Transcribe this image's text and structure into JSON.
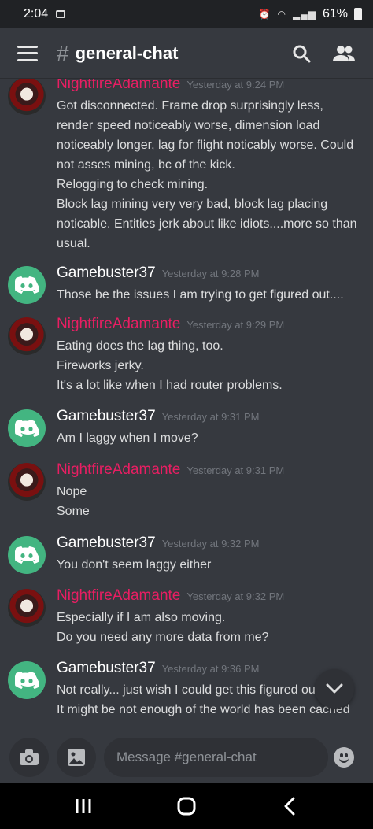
{
  "status_bar": {
    "time": "2:04",
    "battery": "61%"
  },
  "header": {
    "hash": "#",
    "channel": "general-chat"
  },
  "messages": [
    {
      "author": "NightfireAdamante",
      "avatar": "nightfire-avatar",
      "timestamp": "Yesterday at 9:24 PM",
      "lines": [
        "Got disconnected. Frame drop surprisingly less,",
        "render speed noticeably worse, dimension load",
        "noticeably longer, lag for flight noticably worse. Could",
        "not asses mining, bc of the kick.",
        "Relogging to check mining.",
        "Block lag mining very very bad, block lag placing",
        "noticable. Entities jerk about like idiots....more so than",
        "usual."
      ]
    },
    {
      "author": "Gamebuster37",
      "avatar": "discord-avatar",
      "timestamp": "Yesterday at 9:28 PM",
      "lines": [
        "Those be the issues I am trying to get figured out...."
      ]
    },
    {
      "author": "NightfireAdamante",
      "avatar": "nightfire-avatar",
      "timestamp": "Yesterday at 9:29 PM",
      "lines": [
        "Eating does the lag thing, too.",
        "Fireworks jerky.",
        "It's a lot like when I had router problems."
      ]
    },
    {
      "author": "Gamebuster37",
      "avatar": "discord-avatar",
      "timestamp": "Yesterday at 9:31 PM",
      "lines": [
        "Am I laggy when I move?"
      ]
    },
    {
      "author": "NightfireAdamante",
      "avatar": "nightfire-avatar",
      "timestamp": "Yesterday at 9:31 PM",
      "lines": [
        "Nope",
        "Some"
      ]
    },
    {
      "author": "Gamebuster37",
      "avatar": "discord-avatar",
      "timestamp": "Yesterday at 9:32 PM",
      "lines": [
        "You don't seem laggy either"
      ]
    },
    {
      "author": "NightfireAdamante",
      "avatar": "nightfire-avatar",
      "timestamp": "Yesterday at 9:32 PM",
      "lines": [
        "Especially if I am also moving.",
        "Do you need any more data from me?"
      ]
    },
    {
      "author": "Gamebuster37",
      "avatar": "discord-avatar",
      "timestamp": "Yesterday at 9:36 PM",
      "lines": [
        "Not really... just wish I could get this figured out",
        "It might be not enough of the world has been cached"
      ]
    }
  ],
  "composer": {
    "placeholder": "Message #general-chat"
  },
  "colors": {
    "background": "#36393f",
    "nightfire_name": "#e91e63",
    "discord_green": "#43b581"
  }
}
